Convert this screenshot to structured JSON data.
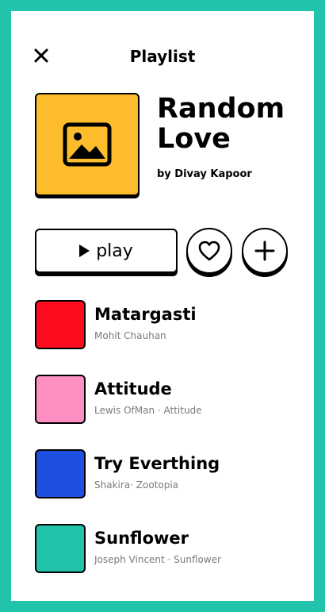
{
  "header": {
    "title": "Playlist",
    "close_icon": "close-icon"
  },
  "album": {
    "title_line1": "Random",
    "title_line2": "Love",
    "author": "by Divay Kapoor",
    "cover_icon": "image-placeholder-icon",
    "cover_color": "#fdbc2c"
  },
  "actions": {
    "play_label": "play",
    "play_icon": "play-icon",
    "like_icon": "heart-icon",
    "add_icon": "plus-icon"
  },
  "tracks": [
    {
      "title": "Matargasti",
      "subtitle": "Mohit Chauhan",
      "color": "#ff0b1e"
    },
    {
      "title": "Attitude",
      "subtitle": "Lewis OfMan · Attitude",
      "color": "#fd8fc2"
    },
    {
      "title": "Try Everthing",
      "subtitle": "Shakira· Zootopia",
      "color": "#1f4fe0"
    },
    {
      "title": "Sunflower",
      "subtitle": "Joseph Vincent · Sunflower",
      "color": "#22c3ab"
    }
  ],
  "theme": {
    "frame_color": "#22c3ab"
  }
}
